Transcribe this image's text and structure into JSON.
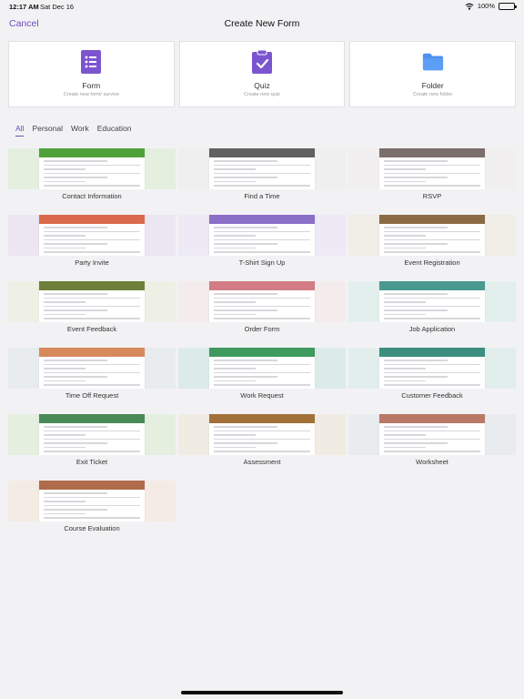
{
  "status": {
    "time": "12:17 AM",
    "date": "Sat Dec 16",
    "battery": "100%",
    "battery_level": 1.0
  },
  "nav": {
    "cancel": "Cancel",
    "title": "Create New Form"
  },
  "types": [
    {
      "label": "Form",
      "sub": "Create new form/ survive",
      "icon": "form-list-icon",
      "color": "#7b55cf"
    },
    {
      "label": "Quiz",
      "sub": "Create new quiz",
      "icon": "quiz-clipboard-icon",
      "color": "#7b55cf"
    },
    {
      "label": "Folder",
      "sub": "Create new folder",
      "icon": "folder-icon",
      "color": "#4f90f0"
    }
  ],
  "tabs": [
    "All",
    "Personal",
    "Work",
    "Education"
  ],
  "active_tab": "All",
  "accent": "#6c4bb8",
  "templates": [
    {
      "name": "Contact Information",
      "bg": "#e4efe0",
      "header": "#4fa23a"
    },
    {
      "name": "Find a Time",
      "bg": "#efefef",
      "header": "#606060"
    },
    {
      "name": "RSVP",
      "bg": "#f1efef",
      "header": "#7a6f6a"
    },
    {
      "name": "Party Invite",
      "bg": "#ebe6f1",
      "header": "#d9694a"
    },
    {
      "name": "T-Shirt Sign Up",
      "bg": "#ede9f5",
      "header": "#8a6fc7"
    },
    {
      "name": "Event Registration",
      "bg": "#f1ede7",
      "header": "#8a6a45"
    },
    {
      "name": "Event Feedback",
      "bg": "#eef0e6",
      "header": "#6e7f3a"
    },
    {
      "name": "Order Form",
      "bg": "#f4ecec",
      "header": "#d27d86"
    },
    {
      "name": "Job Application",
      "bg": "#e3efec",
      "header": "#4a9a8f"
    },
    {
      "name": "Time Off Request",
      "bg": "#e8ecee",
      "header": "#d68a5c"
    },
    {
      "name": "Work Request",
      "bg": "#dcebe8",
      "header": "#3e9a5e"
    },
    {
      "name": "Customer Feedback",
      "bg": "#e2eeec",
      "header": "#3c8e7e"
    },
    {
      "name": "Exit Ticket",
      "bg": "#e4efe0",
      "header": "#4a8a56"
    },
    {
      "name": "Assessment",
      "bg": "#f1ece3",
      "header": "#a2713a"
    },
    {
      "name": "Worksheet",
      "bg": "#e9ecef",
      "header": "#b97865"
    },
    {
      "name": "Course Evaluation",
      "bg": "#f4ebe5",
      "header": "#b06b4c"
    }
  ]
}
